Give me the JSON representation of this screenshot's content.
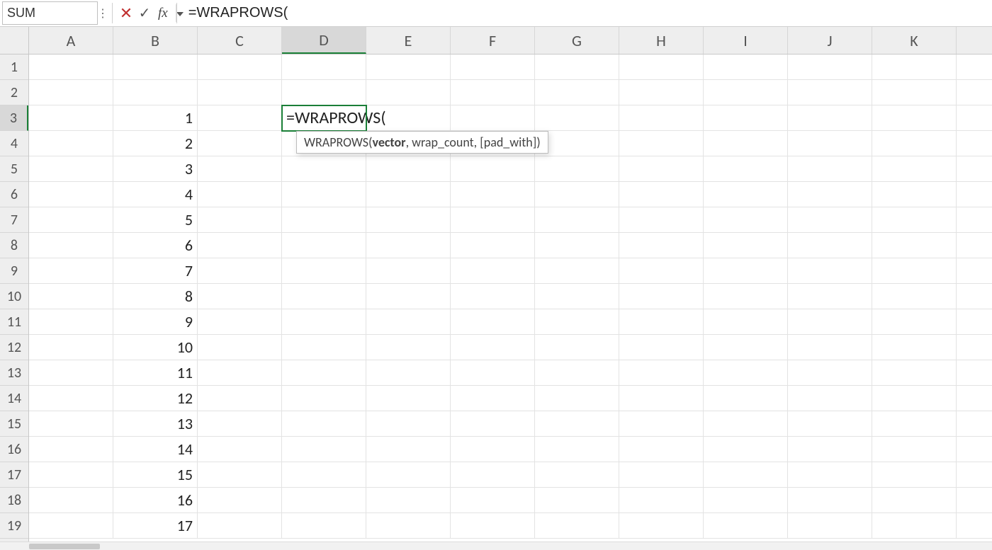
{
  "formula_bar": {
    "name_box_value": "SUM",
    "fx_label": "fx",
    "formula_value": "=WRAPROWS("
  },
  "columns": [
    "A",
    "B",
    "C",
    "D",
    "E",
    "F",
    "G",
    "H",
    "I",
    "J",
    "K"
  ],
  "active_col": "D",
  "rows": [
    "1",
    "2",
    "3",
    "4",
    "5",
    "6",
    "7",
    "8",
    "9",
    "10",
    "11",
    "12",
    "13",
    "14",
    "15",
    "16",
    "17",
    "18",
    "19"
  ],
  "active_row": "3",
  "editing_cell": {
    "ref": "D3",
    "display": "=WRAPROWS("
  },
  "tooltip": {
    "fn": "WRAPROWS(",
    "arg_bold": "vector",
    "rest": ", wrap_count, [pad_with])"
  },
  "column_b_values": [
    "",
    "",
    "1",
    "2",
    "3",
    "4",
    "5",
    "6",
    "7",
    "8",
    "9",
    "10",
    "11",
    "12",
    "13",
    "14",
    "15",
    "16",
    "17"
  ]
}
